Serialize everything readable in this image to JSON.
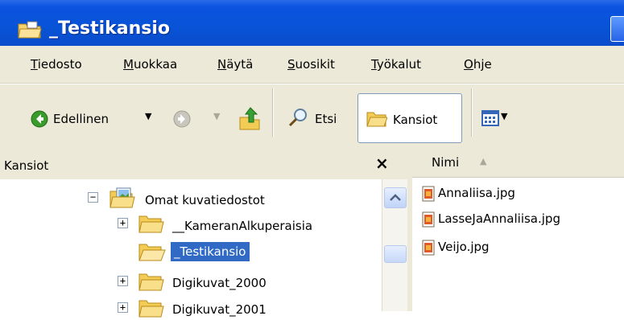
{
  "window": {
    "title": "_Testikansio"
  },
  "menu": [
    "Tiedosto",
    "Muokkaa",
    "Näytä",
    "Suosikit",
    "Työkalut",
    "Ohje"
  ],
  "toolbar": {
    "back_label": "Edellinen",
    "search_label": "Etsi",
    "folders_label": "Kansiot"
  },
  "folders_pane": {
    "header": "Kansiot",
    "close": "×",
    "tree": [
      {
        "label": "Omat kuvatiedostot",
        "expander": "−"
      },
      {
        "label": "__KameranAlkuperaisia",
        "expander": "+"
      },
      {
        "label": "_Testikansio",
        "expander": ""
      },
      {
        "label": "Digikuvat_2000",
        "expander": "+"
      },
      {
        "label": "Digikuvat_2001",
        "expander": "+"
      }
    ]
  },
  "files_pane": {
    "column_name": "Nimi",
    "files": [
      "Annaliisa.jpg",
      "LasseJaAnnaliisa.jpg",
      "Veijo.jpg"
    ]
  },
  "colors": {
    "title_bar": "#0853d6",
    "selection": "#316ac5",
    "chrome": "#ece9d8"
  }
}
